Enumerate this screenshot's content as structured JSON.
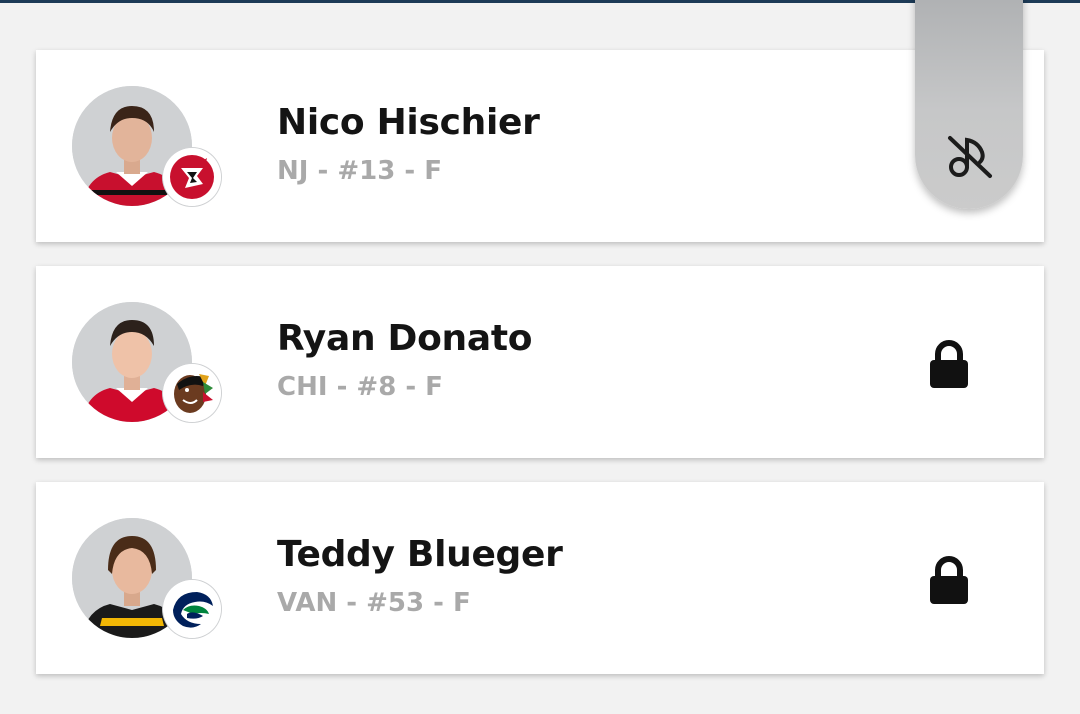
{
  "players": [
    {
      "name": "Nico Hischier",
      "meta": "NJ - #13 - F",
      "team_icon": "devils-logo-icon",
      "status_icon": "none",
      "jersey_color": "#c8102e"
    },
    {
      "name": "Ryan Donato",
      "meta": "CHI - #8 - F",
      "team_icon": "blackhawks-logo-icon",
      "status_icon": "lock-icon",
      "jersey_color": "#cf0a2c"
    },
    {
      "name": "Teddy Blueger",
      "meta": "VAN - #53 - F",
      "team_icon": "canucks-logo-icon",
      "status_icon": "lock-icon",
      "jersey_color": "#1a1a1a"
    }
  ],
  "float_tab": {
    "icon": "no-music-icon"
  },
  "colors": {
    "background": "#f2f2f2",
    "card": "#ffffff",
    "name_text": "#141414",
    "meta_text": "#a9a9a9",
    "top_rule": "#1d3b57"
  }
}
